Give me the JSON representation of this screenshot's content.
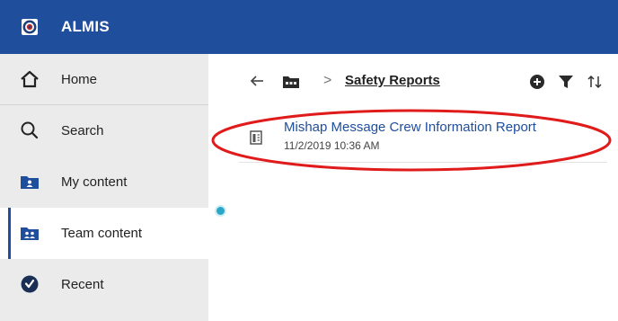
{
  "app": {
    "title": "ALMIS",
    "logo_icon": "coast-guard-seal-icon"
  },
  "sidebar": {
    "items": [
      {
        "label": "Home",
        "icon": "home-icon"
      },
      {
        "label": "Search",
        "icon": "search-icon"
      },
      {
        "label": "My content",
        "icon": "my-content-folder-icon"
      },
      {
        "label": "Team content",
        "icon": "team-content-folder-icon",
        "active": true
      },
      {
        "label": "Recent",
        "icon": "clock-icon"
      }
    ]
  },
  "breadcrumb": {
    "title": "Safety Reports"
  },
  "toolbar": {
    "icons": [
      "back-arrow-icon",
      "folder-icon",
      "add-circle-icon",
      "filter-icon",
      "sort-icon"
    ]
  },
  "content": {
    "items": [
      {
        "title": "Mishap Message Crew Information Report",
        "date": "11/2/2019 10:36 AM",
        "icon": "report-icon"
      }
    ]
  },
  "colors": {
    "brand": "#1f4e9c",
    "accent_dot": "#2aa6c6",
    "annotation": "#e01b1b"
  }
}
